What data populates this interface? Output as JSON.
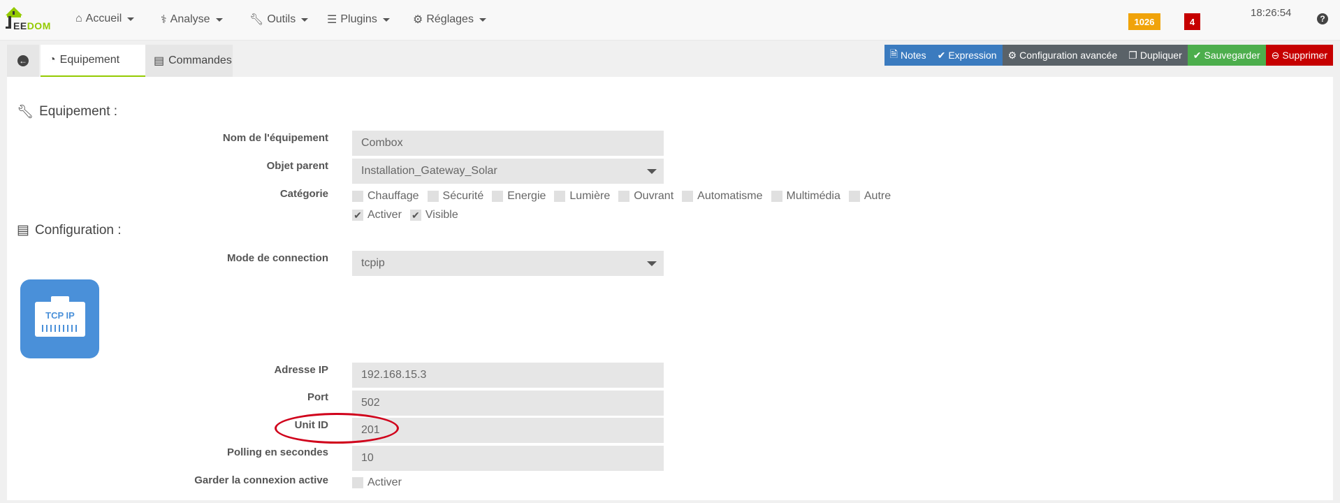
{
  "nav": {
    "logo_ee": "EE",
    "logo_dom": "DOM",
    "menus": [
      {
        "label": "Accueil",
        "icon": "home-icon"
      },
      {
        "label": "Analyse",
        "icon": "stethoscope-icon"
      },
      {
        "label": "Outils",
        "icon": "wrench-icon"
      },
      {
        "label": "Plugins",
        "icon": "list-icon"
      },
      {
        "label": "Réglages",
        "icon": "gear-icon"
      }
    ],
    "badge_messages": "1026",
    "badge_alerts": "4",
    "clock": "18:26:54",
    "help": "?"
  },
  "tabs": {
    "equipement": "Equipement",
    "commandes": "Commandes"
  },
  "actions": {
    "notes": "Notes",
    "expression": "Expression",
    "config_avancee": "Configuration avancée",
    "dupliquer": "Dupliquer",
    "sauvegarder": "Sauvegarder",
    "supprimer": "Supprimer"
  },
  "equipement": {
    "section_title": "Equipement :",
    "name_label": "Nom de l'équipement",
    "name_value": "Combox",
    "parent_label": "Objet parent",
    "parent_value": "Installation_Gateway_Solar",
    "category_label": "Catégorie",
    "categories": [
      "Chauffage",
      "Sécurité",
      "Energie",
      "Lumière",
      "Ouvrant",
      "Automatisme",
      "Multimédia",
      "Autre"
    ],
    "activer": "Activer",
    "visible": "Visible"
  },
  "configuration": {
    "section_title": "Configuration :",
    "mode_label": "Mode de connection",
    "mode_value": "tcpip",
    "tcp_icon_text": "TCP IP",
    "ip_label": "Adresse IP",
    "ip_value": "192.168.15.3",
    "port_label": "Port",
    "port_value": "502",
    "unit_label": "Unit ID",
    "unit_value": "201",
    "polling_label": "Polling en secondes",
    "polling_value": "10",
    "keepalive_label": "Garder la connexion active",
    "keepalive_check": "Activer"
  },
  "colors": {
    "accent_green": "#94ca02",
    "blue": "#3b7bbf",
    "red": "#c60000",
    "highlight": "#d0021b"
  }
}
